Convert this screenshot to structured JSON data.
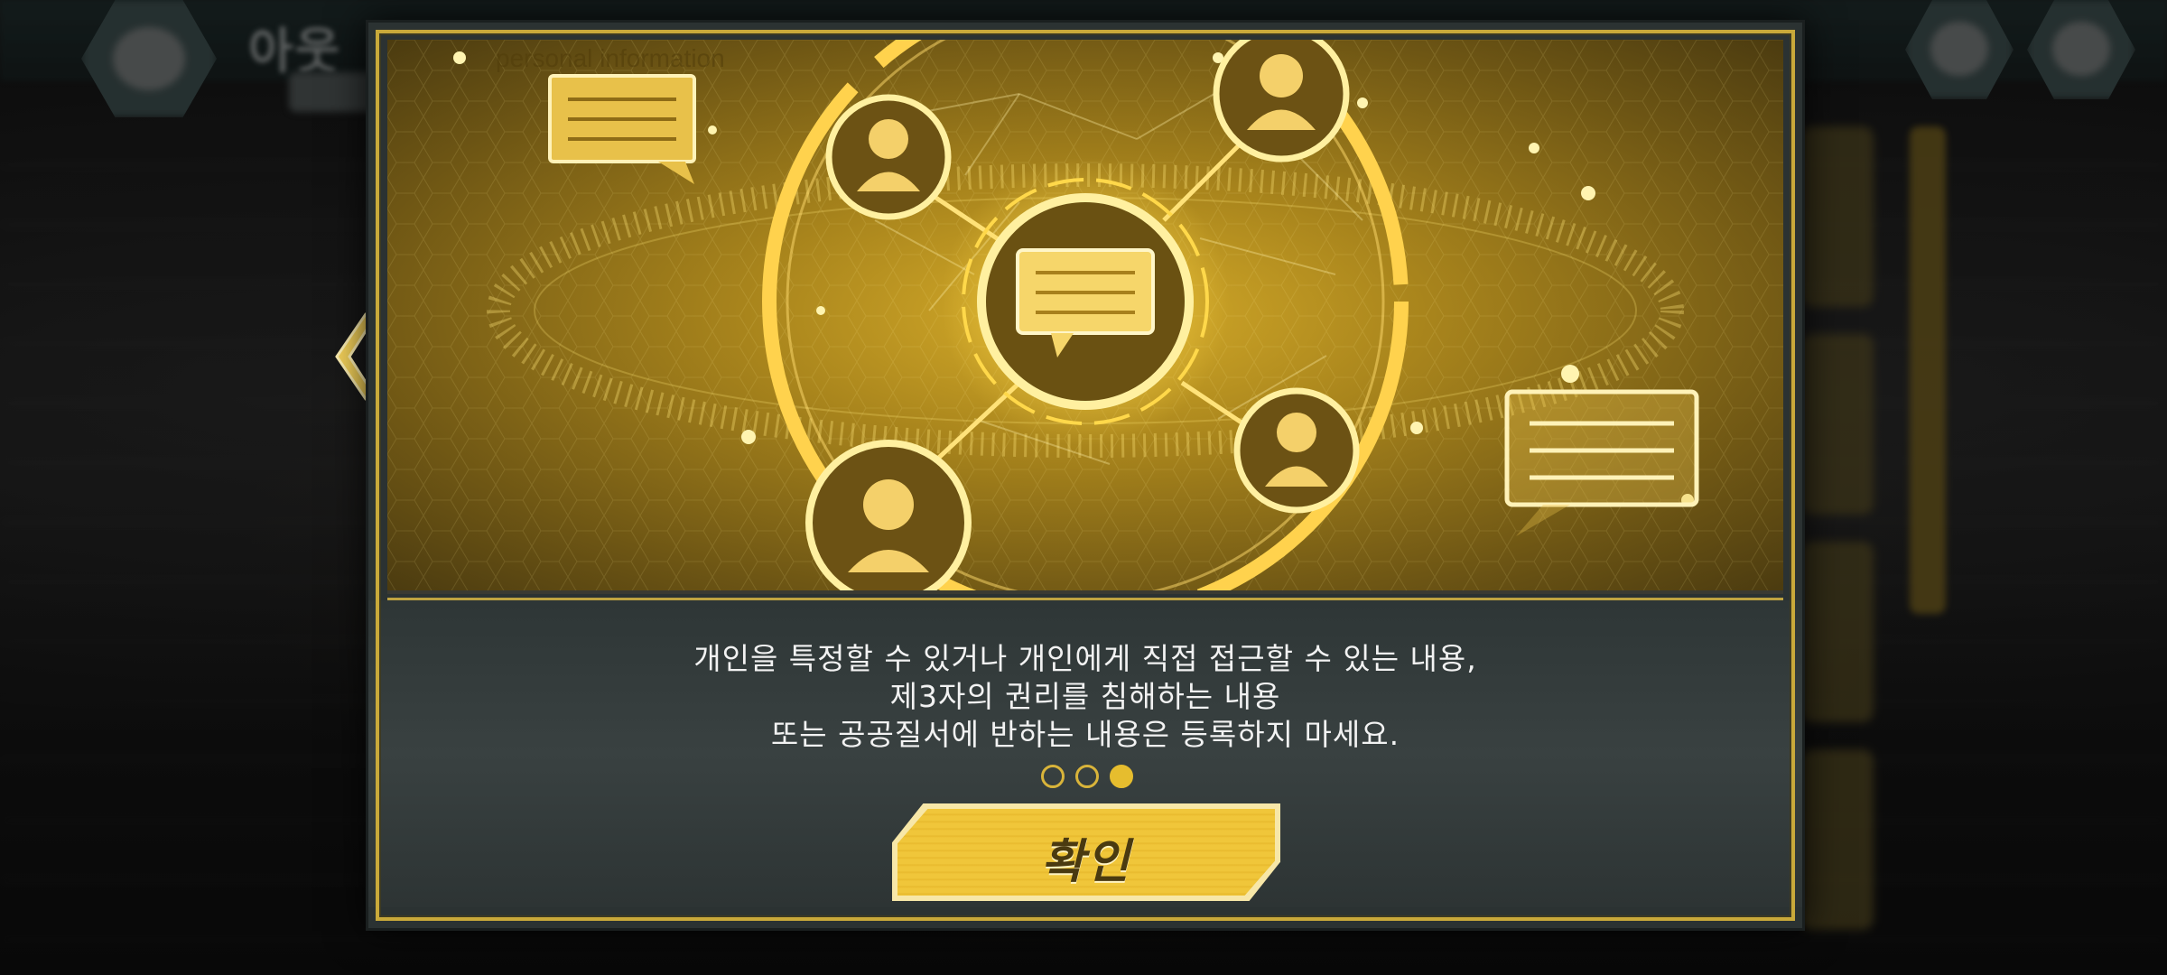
{
  "background": {
    "title": "아웃",
    "dim": true
  },
  "dialog": {
    "message_lines": [
      "개인을 특정할 수 있거나 개인에게 직접 접근할 수 있는 내용,",
      "제3자의 권리를 침해하는 내용",
      "또는 공공질서에 반하는 내용은 등록하지 마세요."
    ],
    "page_indicator": {
      "total": 3,
      "current": 3
    },
    "confirm_label": "확인",
    "banner": {
      "image": "personal-information-network-illustration",
      "watermark_text": "personal information"
    }
  },
  "nav": {
    "prev_icon": "chevron-left-icon"
  },
  "colors": {
    "accent_gold": "#e6bd2e",
    "frame_gold": "#c9a93a",
    "panel_bg": "#2b3232",
    "text": "#f2f2f2"
  }
}
